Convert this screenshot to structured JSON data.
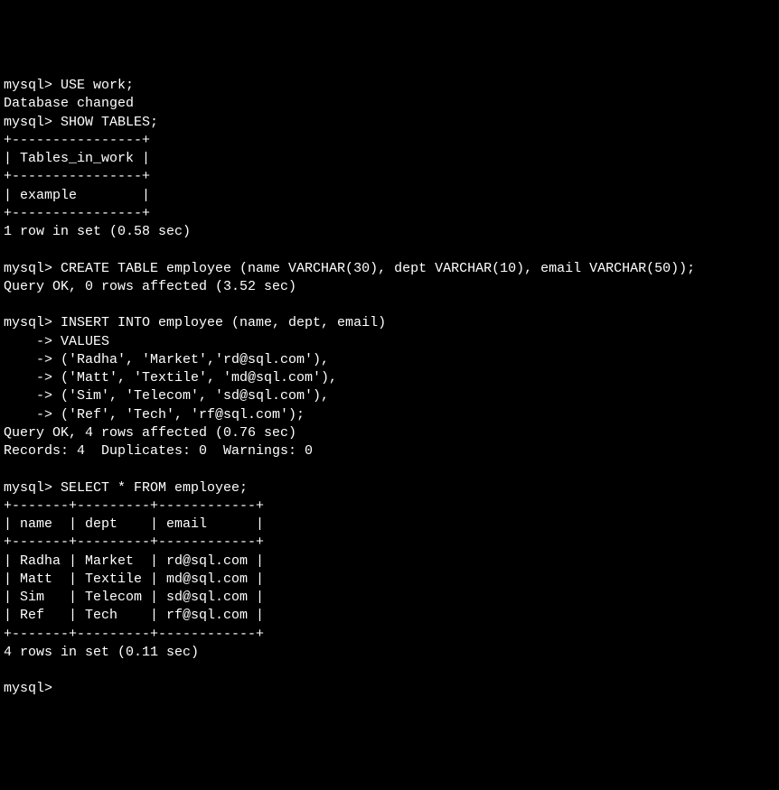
{
  "lines": [
    "mysql> USE work;",
    "Database changed",
    "mysql> SHOW TABLES;",
    "+----------------+",
    "| Tables_in_work |",
    "+----------------+",
    "| example        |",
    "+----------------+",
    "1 row in set (0.58 sec)",
    "",
    "mysql> CREATE TABLE employee (name VARCHAR(30), dept VARCHAR(10), email VARCHAR(50));",
    "Query OK, 0 rows affected (3.52 sec)",
    "",
    "mysql> INSERT INTO employee (name, dept, email)",
    "    -> VALUES",
    "    -> ('Radha', 'Market','rd@sql.com'),",
    "    -> ('Matt', 'Textile', 'md@sql.com'),",
    "    -> ('Sim', 'Telecom', 'sd@sql.com'),",
    "    -> ('Ref', 'Tech', 'rf@sql.com');",
    "Query OK, 4 rows affected (0.76 sec)",
    "Records: 4  Duplicates: 0  Warnings: 0",
    "",
    "mysql> SELECT * FROM employee;",
    "+-------+---------+------------+",
    "| name  | dept    | email      |",
    "+-------+---------+------------+",
    "| Radha | Market  | rd@sql.com |",
    "| Matt  | Textile | md@sql.com |",
    "| Sim   | Telecom | sd@sql.com |",
    "| Ref   | Tech    | rf@sql.com |",
    "+-------+---------+------------+",
    "4 rows in set (0.11 sec)",
    "",
    "mysql>"
  ],
  "chart_data": {
    "type": "table",
    "tables_in_work": [
      "example"
    ],
    "employee_table": {
      "columns": [
        "name",
        "dept",
        "email"
      ],
      "rows": [
        {
          "name": "Radha",
          "dept": "Market",
          "email": "rd@sql.com"
        },
        {
          "name": "Matt",
          "dept": "Textile",
          "email": "md@sql.com"
        },
        {
          "name": "Sim",
          "dept": "Telecom",
          "email": "sd@sql.com"
        },
        {
          "name": "Ref",
          "dept": "Tech",
          "email": "rf@sql.com"
        }
      ]
    },
    "timings": {
      "show_tables": "0.58 sec",
      "create_table": "3.52 sec",
      "insert": "0.76 sec",
      "select": "0.11 sec"
    },
    "commands": [
      "USE work;",
      "SHOW TABLES;",
      "CREATE TABLE employee (name VARCHAR(30), dept VARCHAR(10), email VARCHAR(50));",
      "INSERT INTO employee (name, dept, email) VALUES ('Radha', 'Market','rd@sql.com'), ('Matt', 'Textile', 'md@sql.com'), ('Sim', 'Telecom', 'sd@sql.com'), ('Ref', 'Tech', 'rf@sql.com');",
      "SELECT * FROM employee;"
    ]
  }
}
